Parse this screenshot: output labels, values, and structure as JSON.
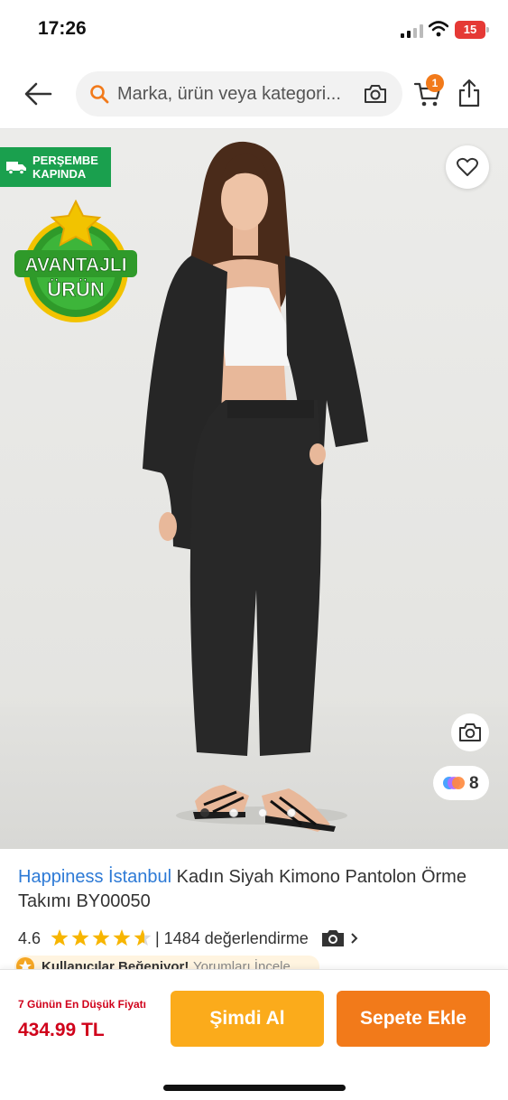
{
  "status_bar": {
    "time": "17:26",
    "battery": "15"
  },
  "header": {
    "search_placeholder": "Marka, ürün veya kategori...",
    "cart_count": "1",
    "icons": [
      "back-arrow-icon",
      "search-icon",
      "camera-icon",
      "cart-icon",
      "share-icon"
    ]
  },
  "gallery": {
    "delivery_badge": [
      "PERŞEMBE",
      "KAPINDA"
    ],
    "advantage_badge": [
      "AVANTAJLI",
      "ÜRÜN"
    ],
    "photo_count": "8",
    "dot_count": 4,
    "active_dot": 0,
    "colors": {
      "delivery_green": "#1aa04e",
      "badge_green": "#2f9a2a",
      "badge_yellow": "#f2c300"
    }
  },
  "product": {
    "brand": "Happiness İstanbul",
    "name": "Kadın Siyah Kimono Pantolon Örme Takımı BY00050",
    "rating": "4.6",
    "rating_value": 4.6,
    "review_count_text": "| 1484 değerlendirme",
    "liked_text": "Kullanıcılar Beğeniyor!",
    "reviews_link": "Yorumları İncele"
  },
  "purchase": {
    "lowest_price_label": "7 Günün En Düşük Fiyatı",
    "price": "434.99 TL",
    "buy_now_label": "Şimdi Al",
    "add_to_cart_label": "Sepete Ekle",
    "colors": {
      "price_red": "#d0021b",
      "buy_now": "#fbab1b",
      "add_to_cart": "#f27a1a"
    }
  }
}
